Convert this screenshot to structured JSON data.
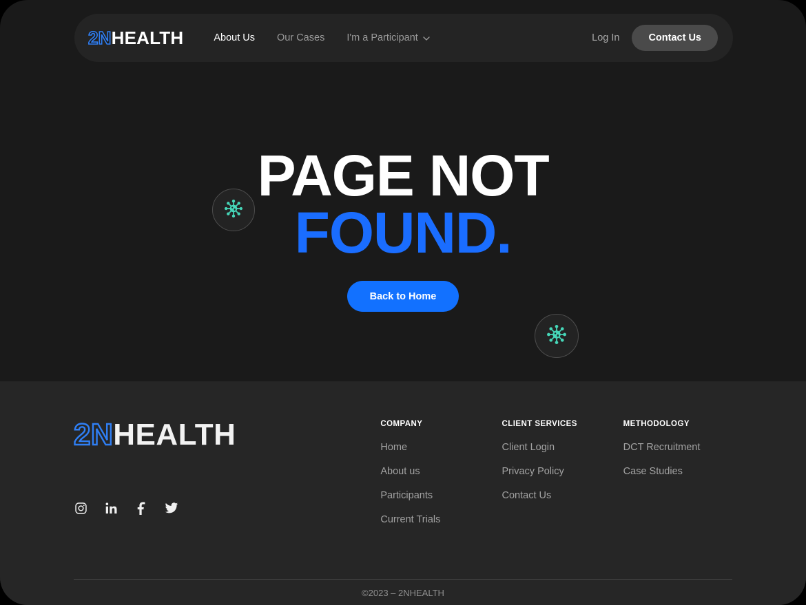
{
  "theme": {
    "page_bg": "#1a1a1a",
    "footer_bg": "#262626",
    "navbar_bg": "#242424",
    "accent_blue": "#1271ff",
    "heading_blue": "#1a6dff",
    "logo_blue": "#2f7ff5",
    "virus_teal": "#46d6b8",
    "muted_text": "#9a9a9a"
  },
  "navbar": {
    "logo": {
      "mark": "2N",
      "word": "HEALTH"
    },
    "links": [
      {
        "label": "About Us",
        "active": true,
        "has_chevron": false
      },
      {
        "label": "Our Cases",
        "active": false,
        "has_chevron": false
      },
      {
        "label": "I'm a Participant",
        "active": false,
        "has_chevron": true
      }
    ],
    "login_label": "Log In",
    "contact_label": "Contact Us"
  },
  "hero": {
    "heading_line1": "PAGE NOT",
    "heading_line2": "FOUND.",
    "button_label": "Back to Home",
    "decorations": [
      {
        "icon": "virus-icon"
      },
      {
        "icon": "virus-icon"
      }
    ]
  },
  "footer": {
    "logo": {
      "mark": "2N",
      "word": "HEALTH"
    },
    "socials": [
      {
        "icon": "instagram-icon",
        "name": "Instagram"
      },
      {
        "icon": "linkedin-icon",
        "name": "LinkedIn"
      },
      {
        "icon": "facebook-icon",
        "name": "Facebook"
      },
      {
        "icon": "twitter-icon",
        "name": "Twitter"
      }
    ],
    "columns": [
      {
        "title": "COMPANY",
        "links": [
          "Home",
          "About us",
          "Participants",
          "Current Trials"
        ]
      },
      {
        "title": "CLIENT SERVICES",
        "links": [
          "Client Login",
          "Privacy Policy",
          "Contact Us"
        ]
      },
      {
        "title": "METHODOLOGY",
        "links": [
          "DCT Recruitment",
          "Case Studies"
        ]
      }
    ],
    "copyright": "©2023 – 2NHEALTH"
  }
}
